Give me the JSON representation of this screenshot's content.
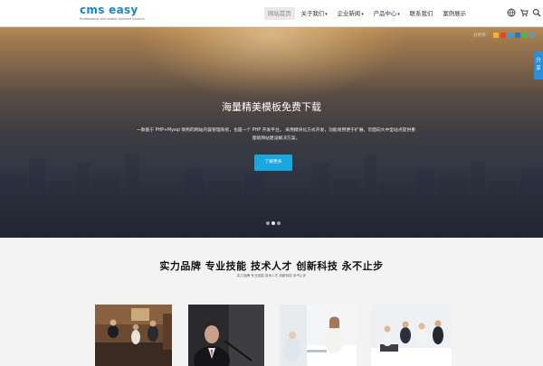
{
  "logo": {
    "mark": "cms easy",
    "tagline": "Professional and stable Internet Service"
  },
  "nav": {
    "items": [
      {
        "label": "网站首页",
        "active": true,
        "has_dropdown": false
      },
      {
        "label": "关于我们",
        "active": false,
        "has_dropdown": true
      },
      {
        "label": "企业新闻",
        "active": false,
        "has_dropdown": true
      },
      {
        "label": "产品中心",
        "active": false,
        "has_dropdown": true
      },
      {
        "label": "联系我们",
        "active": false,
        "has_dropdown": false
      },
      {
        "label": "案例展示",
        "active": false,
        "has_dropdown": false
      }
    ],
    "icons": [
      "globe-icon",
      "cart-icon",
      "search-icon"
    ]
  },
  "hero": {
    "share_label": "分享到：",
    "share_icons": [
      "qzone-icon",
      "weibo-icon",
      "tencent-weibo-icon",
      "renren-icon",
      "wechat-icon",
      "more-icon"
    ],
    "title": "海量精美模板免费下载",
    "description": "一款基于 PHP+Mysql 架构的网站内容管理系统，也是一个 PHP 开发平台。 采用模块化方式开发，功能易用便于扩展，可面向大中型站点提供重量级网站建设解决方案。",
    "button_label": "了解更多",
    "slide_count": 3,
    "active_slide": 2
  },
  "float_share": {
    "label": "分享"
  },
  "section": {
    "slogan": "实力品牌 专业技能 技术人才 创新科技 永不止步",
    "subtitle": "实力品牌 专业技能 技术人才 创新科技 永不止步"
  },
  "thumbnails": [
    "meeting-photo",
    "speaker-photo",
    "office-photo",
    "team-photo"
  ],
  "colors": {
    "accent": "#1aa7e0",
    "logo": "#1a86d0",
    "float_share": "#2a8ede"
  }
}
